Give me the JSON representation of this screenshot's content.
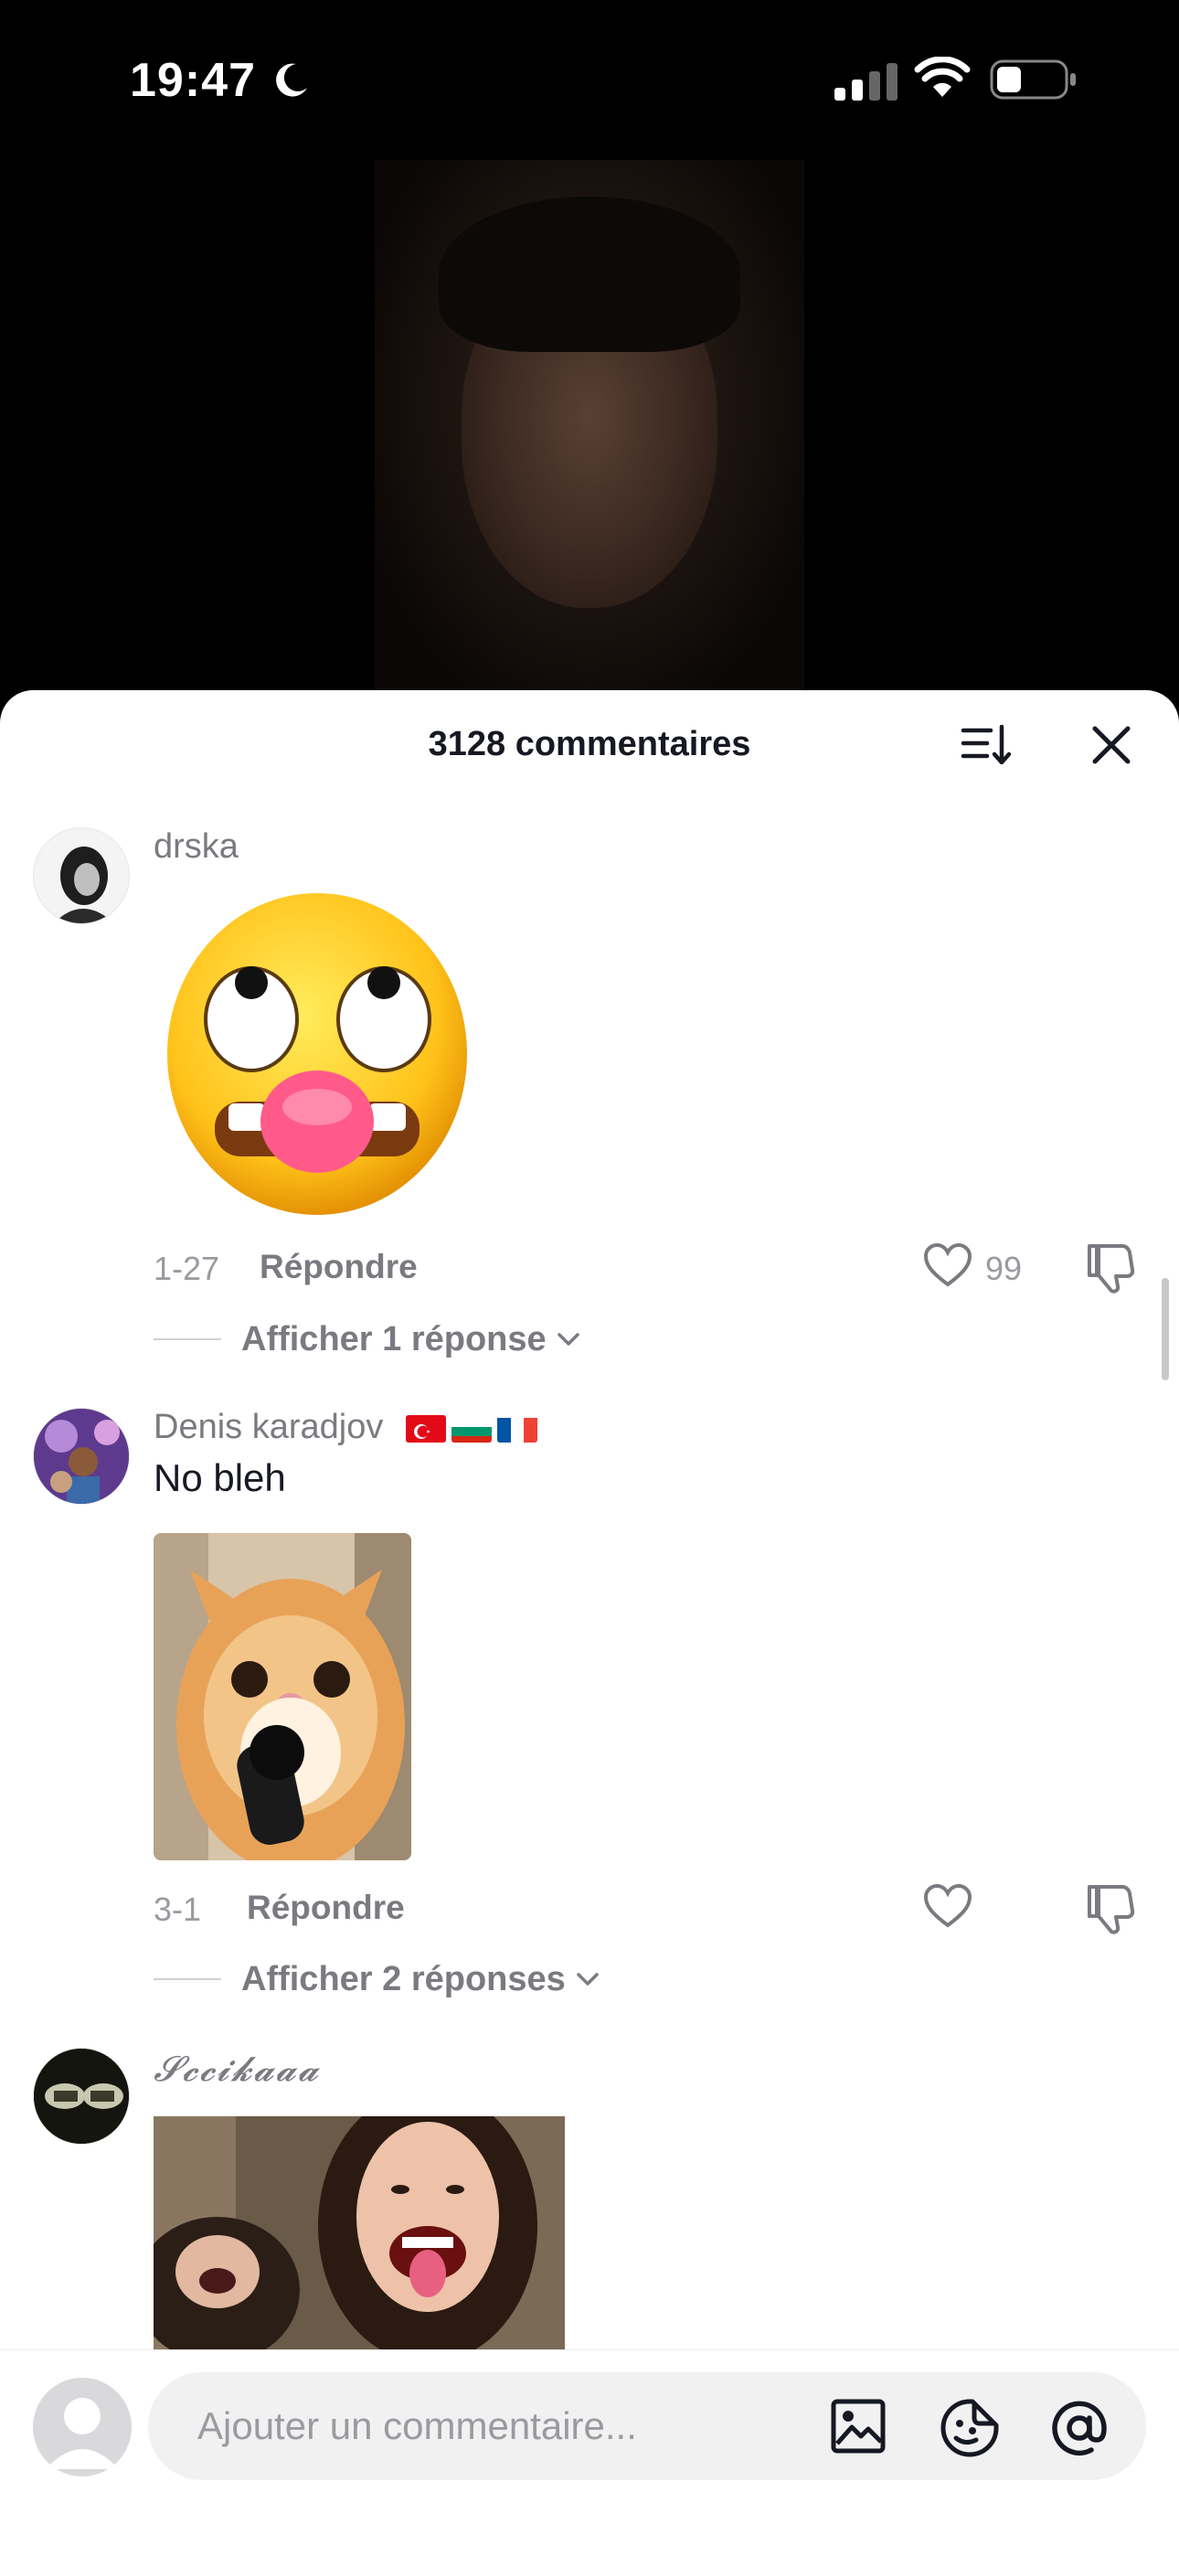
{
  "status": {
    "time": "19:47"
  },
  "sheet": {
    "title": "3128 commentaires"
  },
  "comments": [
    {
      "username": "drska",
      "date": "1-27",
      "reply_label": "Répondre",
      "likes": "99",
      "view_replies": "Afficher 1 réponse"
    },
    {
      "username": "Denis karadjov",
      "text": "No bleh",
      "date": "3-1",
      "reply_label": "Répondre",
      "view_replies": "Afficher 2 réponses"
    },
    {
      "username": "𝓢𝓬𝓬𝓲𝓴𝓪𝓪𝓪"
    }
  ],
  "input": {
    "placeholder": "Ajouter un commentaire..."
  },
  "colors": {
    "text": "#161823",
    "secondary": "#7a7a80",
    "background": "#ffffff"
  }
}
